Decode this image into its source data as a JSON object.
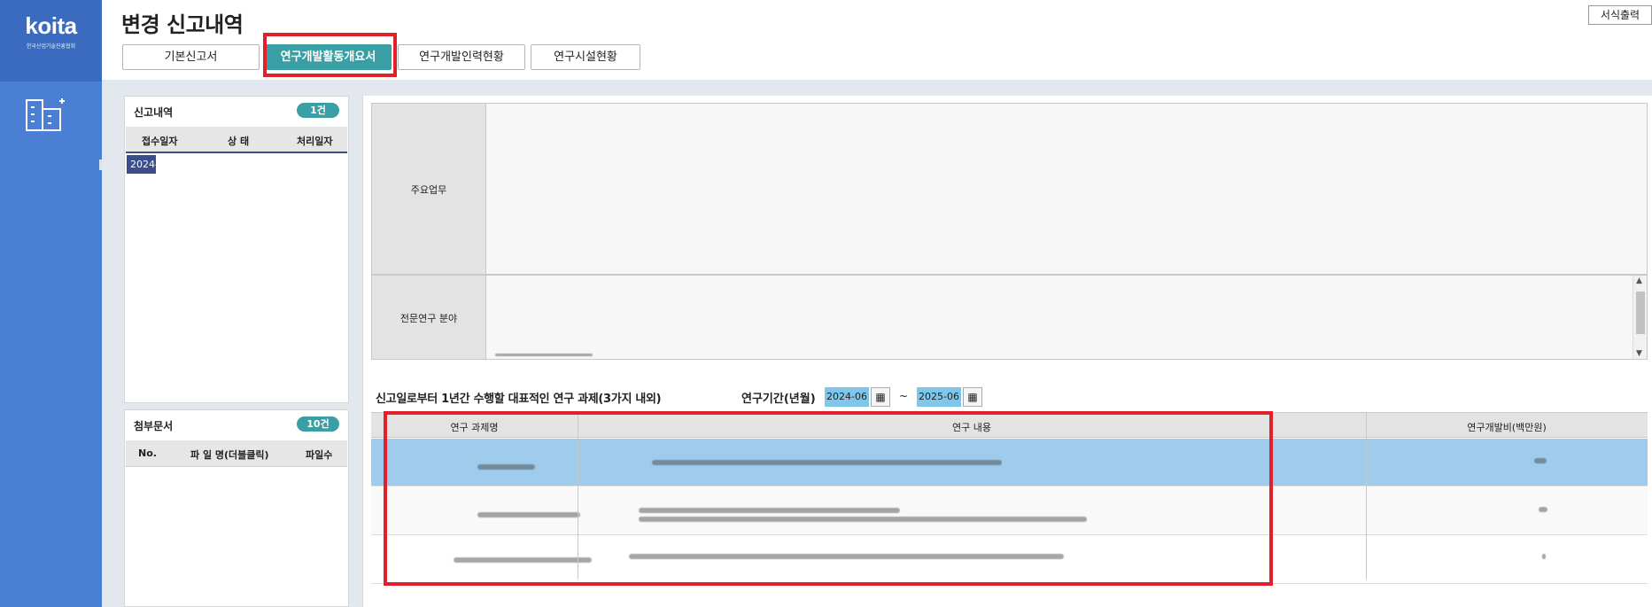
{
  "app": {
    "logo_text": "koita",
    "logo_subtext": "한국산업기술진흥협회",
    "page_title": "변경 신고내역",
    "print_button": "서식출력"
  },
  "tabs": [
    {
      "label": "기본신고서",
      "active": false
    },
    {
      "label": "연구개발활동개요서",
      "active": true
    },
    {
      "label": "연구개발인력현황",
      "active": false
    },
    {
      "label": "연구시설현황",
      "active": false
    }
  ],
  "report_panel": {
    "title": "신고내역",
    "badge": "1건",
    "columns": [
      "접수일자",
      "상 태",
      "처리일자"
    ],
    "rows": [
      [
        "2024-",
        "",
        ""
      ]
    ]
  },
  "attachment_panel": {
    "title": "첨부문서",
    "badge": "10건",
    "columns": [
      "No.",
      "파 일 명(더블클릭)",
      "파일수"
    ]
  },
  "info": {
    "main_business_label": "주요업무",
    "research_field_label": "전문연구 분야"
  },
  "research": {
    "section_title": "신고일로부터 1년간 수행할 대표적인 연구 과제(3가지 내외)",
    "period_label": "연구기간(년월)",
    "period_start": "2024-06",
    "period_end": "2025-06",
    "period_separator": "~",
    "columns": [
      "연구 과제명",
      "연구 내용",
      "연구개발비(백만원)"
    ]
  },
  "colors": {
    "sidebar": "#4a7fd4",
    "accent_teal": "#3a9ea5",
    "highlight_red": "#e0202a",
    "selected_row": "#9fcbec"
  }
}
